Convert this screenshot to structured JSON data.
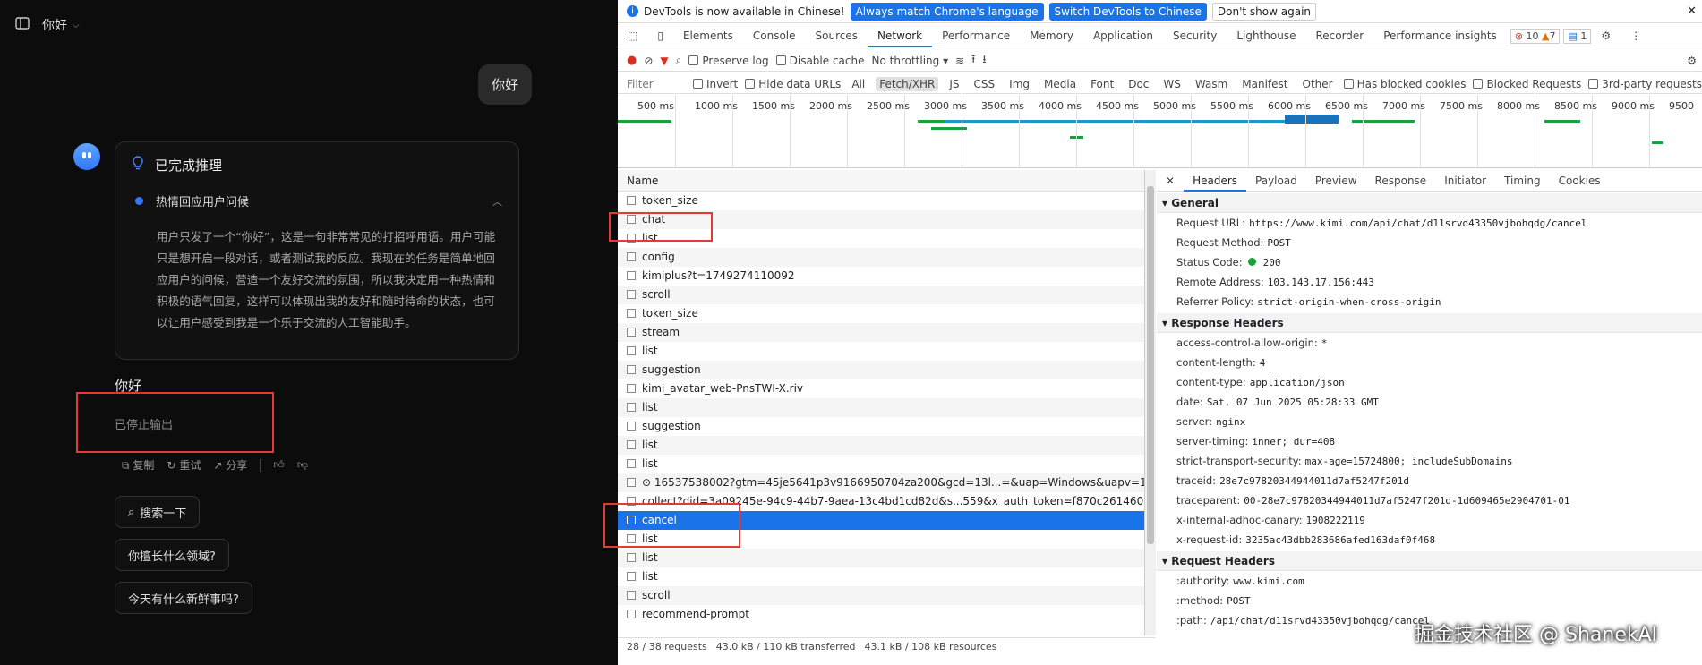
{
  "chat": {
    "header_title": "你好",
    "user_message": "你好",
    "reasoning": {
      "title": "已完成推理",
      "step": "热情回应用户问候",
      "text": "用户只发了一个“你好”，这是一句非常常见的打招呼用语。用户可能只是想开启一段对话，或者测试我的反应。我现在的任务是简单地回应用户的问候，营造一个友好交流的氛围，所以我决定用一种热情和积极的语气回复，这样可以体现出我的友好和随时待命的状态，也可以让用户感受到我是一个乐于交流的人工智能助手。"
    },
    "reply": "你好",
    "stopped": "已停止输出",
    "actions": {
      "copy": "复制",
      "retry": "重试",
      "share": "分享"
    },
    "suggestions": [
      "搜索一下",
      "你擅长什么领域?",
      "今天有什么新鲜事吗?"
    ]
  },
  "devtools": {
    "infobar": {
      "message": "DevTools is now available in Chinese!",
      "btn_match": "Always match Chrome's language",
      "btn_switch": "Switch DevTools to Chinese",
      "btn_dismiss": "Don't show again"
    },
    "tabs": [
      "Elements",
      "Console",
      "Sources",
      "Network",
      "Performance",
      "Memory",
      "Application",
      "Security",
      "Lighthouse",
      "Recorder",
      "Performance insights"
    ],
    "errors": "10",
    "warnings": "7",
    "messages": "1",
    "toolbar": {
      "preserve_log": "Preserve log",
      "disable_cache": "Disable cache",
      "throttling": "No throttling"
    },
    "filter": {
      "placeholder": "Filter",
      "invert": "Invert",
      "hide_data_urls": "Hide data URLs",
      "types": [
        "All",
        "Fetch/XHR",
        "JS",
        "CSS",
        "Img",
        "Media",
        "Font",
        "Doc",
        "WS",
        "Wasm",
        "Manifest",
        "Other"
      ],
      "has_blocked_cookies": "Has blocked cookies",
      "blocked_requests": "Blocked Requests",
      "third_party": "3rd-party requests"
    },
    "timeline_ticks": [
      "500 ms",
      "1000 ms",
      "1500 ms",
      "2000 ms",
      "2500 ms",
      "3000 ms",
      "3500 ms",
      "4000 ms",
      "4500 ms",
      "5000 ms",
      "5500 ms",
      "6000 ms",
      "6500 ms",
      "7000 ms",
      "7500 ms",
      "8000 ms",
      "8500 ms",
      "9000 ms",
      "9500"
    ],
    "list_header": "Name",
    "requests": [
      "token_size",
      "chat",
      "list",
      "config",
      "kimiplus?t=1749274110092",
      "scroll",
      "token_size",
      "stream",
      "list",
      "suggestion",
      "kimi_avatar_web-PnsTWI-X.riv",
      "list",
      "suggestion",
      "list",
      "list",
      "⊙ 16537538002?gtm=45je5641p3v9166950704za200&gcd=13l...=&uap=Windows&uapv=10.0.0&uaw=1",
      "collect?did=3a09245e-94c9-44b7-9aea-13c4bd1cd82d&s...559&x_auth_token=f870c26146004d2e80179f",
      "cancel",
      "list",
      "list",
      "list",
      "scroll",
      "recommend-prompt"
    ],
    "selected_request": "cancel",
    "status": {
      "requests": "28 / 38 requests",
      "transferred": "43.0 kB / 110 kB transferred",
      "resources": "43.1 kB / 108 kB resources"
    },
    "detail_tabs": [
      "Headers",
      "Payload",
      "Preview",
      "Response",
      "Initiator",
      "Timing",
      "Cookies"
    ],
    "general": {
      "title": "General",
      "items": [
        {
          "k": "Request URL:",
          "v": "https://www.kimi.com/api/chat/d11srvd43350vjbohqdg/cancel"
        },
        {
          "k": "Request Method:",
          "v": "POST"
        },
        {
          "k": "Status Code:",
          "v": "200"
        },
        {
          "k": "Remote Address:",
          "v": "103.143.17.156:443"
        },
        {
          "k": "Referrer Policy:",
          "v": "strict-origin-when-cross-origin"
        }
      ]
    },
    "response_headers": {
      "title": "Response Headers",
      "items": [
        {
          "k": "access-control-allow-origin:",
          "v": "*"
        },
        {
          "k": "content-length:",
          "v": "4"
        },
        {
          "k": "content-type:",
          "v": "application/json"
        },
        {
          "k": "date:",
          "v": "Sat, 07 Jun 2025 05:28:33 GMT"
        },
        {
          "k": "server:",
          "v": "nginx"
        },
        {
          "k": "server-timing:",
          "v": "inner; dur=408"
        },
        {
          "k": "strict-transport-security:",
          "v": "max-age=15724800; includeSubDomains"
        },
        {
          "k": "traceid:",
          "v": "28e7c97820344944011d7af5247f201d"
        },
        {
          "k": "traceparent:",
          "v": "00-28e7c97820344944011d7af5247f201d-1d609465e2904701-01"
        },
        {
          "k": "x-internal-adhoc-canary:",
          "v": "1908222119"
        },
        {
          "k": "x-request-id:",
          "v": "3235ac43dbb283686afed163daf0f468"
        }
      ]
    },
    "request_headers": {
      "title": "Request Headers",
      "items": [
        {
          "k": ":authority:",
          "v": "www.kimi.com"
        },
        {
          "k": ":method:",
          "v": "POST"
        },
        {
          "k": ":path:",
          "v": "/api/chat/d11srvd43350vjbohqdg/cancel"
        }
      ]
    }
  },
  "watermark": "掘金技术社区 @ ShanekAI"
}
